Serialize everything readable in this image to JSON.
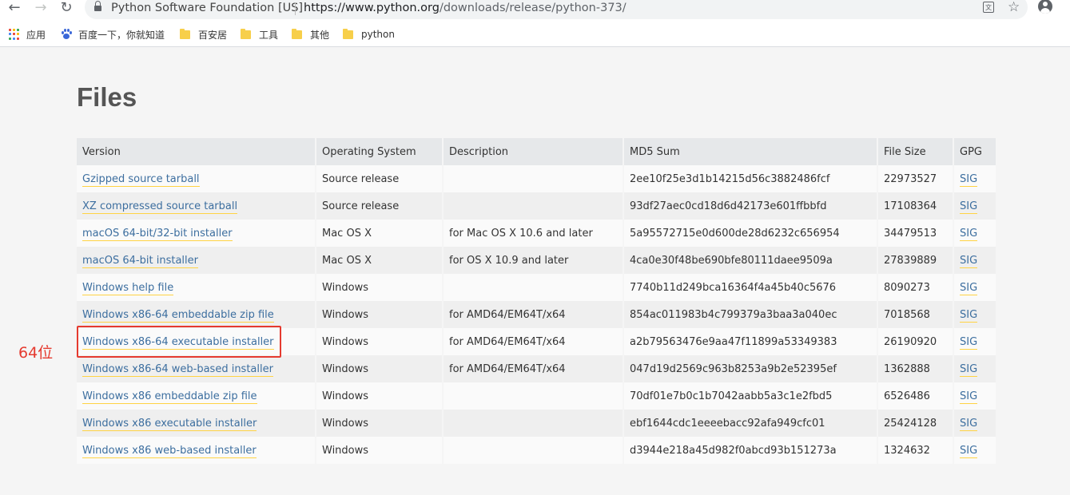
{
  "browser": {
    "site_identity": "Python Software Foundation [US]",
    "url_host": "https://www.python.org",
    "url_path": "/downloads/release/python-373/",
    "back_glyph": "←",
    "forward_glyph": "→",
    "reload_glyph": "↻",
    "translate_glyph": "文",
    "star_glyph": "☆"
  },
  "bookmarks": [
    {
      "label": "应用",
      "icon": "apps-grid-icon"
    },
    {
      "label": "百度一下，你就知道",
      "icon": "baidu-paw-icon"
    },
    {
      "label": "百安居",
      "icon": "folder-icon"
    },
    {
      "label": "工具",
      "icon": "folder-icon"
    },
    {
      "label": "其他",
      "icon": "folder-icon"
    },
    {
      "label": "python",
      "icon": "folder-icon"
    }
  ],
  "colors": {
    "link": "#3c6e9f",
    "link_underline": "#ffd343",
    "annotation": "#e53a2f",
    "header_bg": "#e6e8ea"
  },
  "page": {
    "title": "Files"
  },
  "table": {
    "headers": [
      "Version",
      "Operating System",
      "Description",
      "MD5 Sum",
      "File Size",
      "GPG"
    ],
    "rows": [
      {
        "version": "Gzipped source tarball",
        "os": "Source release",
        "description": "",
        "md5": "2ee10f25e3d1b14215d56c3882486fcf",
        "size": "22973527",
        "gpg": "SIG"
      },
      {
        "version": "XZ compressed source tarball",
        "os": "Source release",
        "description": "",
        "md5": "93df27aec0cd18d6d42173e601ffbbfd",
        "size": "17108364",
        "gpg": "SIG"
      },
      {
        "version": "macOS 64-bit/32-bit installer",
        "os": "Mac OS X",
        "description": "for Mac OS X 10.6 and later",
        "md5": "5a95572715e0d600de28d6232c656954",
        "size": "34479513",
        "gpg": "SIG"
      },
      {
        "version": "macOS 64-bit installer",
        "os": "Mac OS X",
        "description": "for OS X 10.9 and later",
        "md5": "4ca0e30f48be690bfe80111daee9509a",
        "size": "27839889",
        "gpg": "SIG"
      },
      {
        "version": "Windows help file",
        "os": "Windows",
        "description": "",
        "md5": "7740b11d249bca16364f4a45b40c5676",
        "size": "8090273",
        "gpg": "SIG"
      },
      {
        "version": "Windows x86-64 embeddable zip file",
        "os": "Windows",
        "description": "for AMD64/EM64T/x64",
        "md5": "854ac011983b4c799379a3baa3a040ec",
        "size": "7018568",
        "gpg": "SIG"
      },
      {
        "version": "Windows x86-64 executable installer",
        "os": "Windows",
        "description": "for AMD64/EM64T/x64",
        "md5": "a2b79563476e9aa47f11899a53349383",
        "size": "26190920",
        "gpg": "SIG"
      },
      {
        "version": "Windows x86-64 web-based installer",
        "os": "Windows",
        "description": "for AMD64/EM64T/x64",
        "md5": "047d19d2569c963b8253a9b2e52395ef",
        "size": "1362888",
        "gpg": "SIG"
      },
      {
        "version": "Windows x86 embeddable zip file",
        "os": "Windows",
        "description": "",
        "md5": "70df01e7b0c1b7042aabb5a3c1e2fbd5",
        "size": "6526486",
        "gpg": "SIG"
      },
      {
        "version": "Windows x86 executable installer",
        "os": "Windows",
        "description": "",
        "md5": "ebf1644cdc1eeeebacc92afa949cfc01",
        "size": "25424128",
        "gpg": "SIG"
      },
      {
        "version": "Windows x86 web-based installer",
        "os": "Windows",
        "description": "",
        "md5": "d3944e218a45d982f0abcd93b151273a",
        "size": "1324632",
        "gpg": "SIG"
      }
    ]
  },
  "annotation": {
    "label": "64位"
  }
}
